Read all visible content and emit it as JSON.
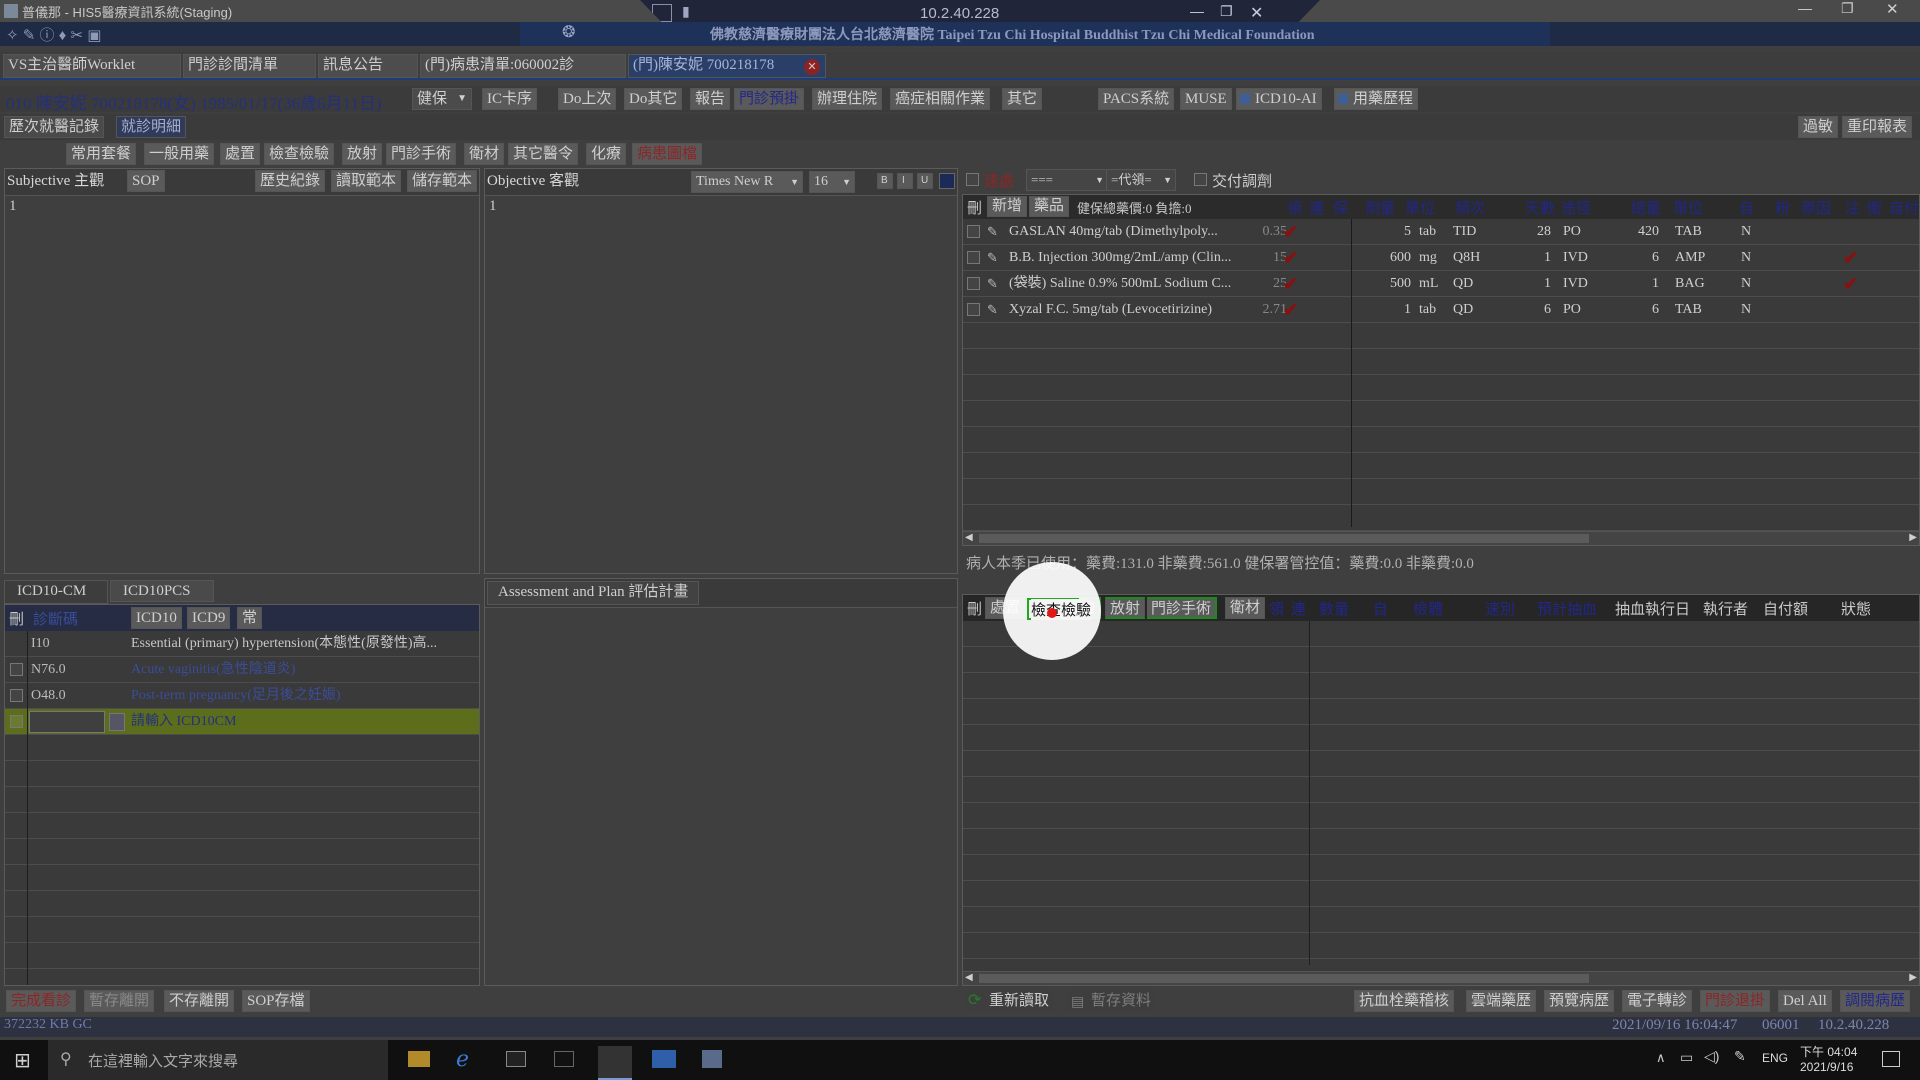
{
  "titlebar": {
    "title": "普儀那 - HIS5醫療資訊系統(Staging)",
    "remote_ip": "10.2.40.228",
    "hospital_banner": "佛教慈濟醫療財團法人台北慈濟醫院 Taipei Tzu Chi Hospital Buddhist Tzu Chi Medical Foundation"
  },
  "main_tabs": [
    "VS主治醫師Worklet",
    "門診診間清單",
    "訊息公告",
    "(門)病患清單:060002診",
    "(門)陳安妮 700218178"
  ],
  "patient": {
    "info": "010  陳安妮 700218178(女) 1985/01/17(36歲6月11日)",
    "insurance": "健保"
  },
  "patient_toolbar": [
    "IC卡序",
    "Do上次",
    "Do其它",
    "報告",
    "門診預掛",
    "辦理住院",
    "癌症相關作業",
    "其它",
    "PACS系統",
    "MUSE",
    "ICD10-AI",
    "用藥歷程"
  ],
  "subtabs": {
    "history": "歷次就醫記錄",
    "detail": "就診明細"
  },
  "right_buttons": {
    "allergy": "過敏",
    "reprint": "重印報表"
  },
  "order_toolbar": [
    "常用套餐",
    "一般用藥",
    "處置",
    "檢查檢驗",
    "放射",
    "門診手術",
    "衛材",
    "其它醫令",
    "化療",
    "病患圖檔"
  ],
  "subjective": {
    "title": "Subjective 主觀",
    "sop": "SOP",
    "history": "歷史紀錄",
    "read_tpl": "讀取範本",
    "save_tpl": "儲存範本",
    "text": "1"
  },
  "objective": {
    "title": "Objective 客觀",
    "font": "Times New R",
    "size": "16",
    "text": "1"
  },
  "drug_filters": {
    "same_place": "速處",
    "combo1": "===",
    "combo2": "=代領=",
    "deliver": "交付調劑"
  },
  "drug_table": {
    "headers": [
      "刪",
      "新增",
      "藥品",
      "健保總藥價:0 負擔:0",
      "領",
      "連",
      "保",
      "劑量",
      "單位",
      "頻次",
      "天數",
      "途徑",
      "總量",
      "單位",
      "自",
      "粉",
      "原因",
      "注",
      "衛",
      "自付"
    ],
    "rows": [
      {
        "name": "GASLAN 40mg/tab (Dimethylpoly...",
        "price": "0.35",
        "dose": "5",
        "unit": "tab",
        "freq": "TID",
        "days": "28",
        "route": "PO",
        "total": "420",
        "tunit": "TAB",
        "self": "N",
        "inj": false
      },
      {
        "name": "B.B. Injection 300mg/2mL/amp (Clin...",
        "price": "15",
        "dose": "600",
        "unit": "mg",
        "freq": "Q8H",
        "days": "1",
        "route": "IVD",
        "total": "6",
        "tunit": "AMP",
        "self": "N",
        "inj": true
      },
      {
        "name": "(袋裝) Saline 0.9% 500mL Sodium C...",
        "price": "25",
        "dose": "500",
        "unit": "mL",
        "freq": "QD",
        "days": "1",
        "route": "IVD",
        "total": "1",
        "tunit": "BAG",
        "self": "N",
        "inj": true
      },
      {
        "name": "Xyzal F.C. 5mg/tab (Levocetirizine)",
        "price": "2.71",
        "dose": "1",
        "unit": "tab",
        "freq": "QD",
        "days": "6",
        "route": "PO",
        "total": "6",
        "tunit": "TAB",
        "self": "N",
        "inj": false
      }
    ]
  },
  "usage_summary": "病人本季已使用：藥費:131.0 非藥費:561.0 健保署管控值：藥費:0.0 非藥費:0.0",
  "icd": {
    "tabs": [
      "ICD10-CM",
      "ICD10PCS"
    ],
    "headers": {
      "del": "刪",
      "code": "診斷碼",
      "icd10": "ICD10",
      "icd9": "ICD9",
      "common": "常"
    },
    "rows": [
      {
        "code": "I10",
        "desc": "Essential (primary) hypertension(本態性(原發性)高..."
      },
      {
        "code": "N76.0",
        "desc": "Acute vaginitis(急性陰道炎)"
      },
      {
        "code": "O48.0",
        "desc": "Post-term pregnancy(足月後之妊娠)"
      }
    ],
    "input_prompt": "請輸入 ICD10CM"
  },
  "assessment": {
    "title": "Assessment and Plan 評估計畫"
  },
  "lab_table": {
    "headers": [
      "刪",
      "處置",
      "檢查檢驗",
      "放射",
      "門診手術",
      "衛材",
      "領",
      "連",
      "數量",
      "自",
      "檢體",
      "速別",
      "預計抽血",
      "抽血執行日",
      "執行者",
      "自付額",
      "狀態"
    ]
  },
  "bottom_left": [
    "完成看診",
    "暫存離開",
    "不存離開",
    "SOP存檔"
  ],
  "bottom_mid": {
    "reload": "重新讀取",
    "temp": "暫存資料"
  },
  "bottom_right": [
    "抗血栓藥稽核",
    "雲端藥歷",
    "預覽病歷",
    "電子轉診",
    "門診退掛",
    "Del All",
    "調閱病歷"
  ],
  "statusbar": {
    "memory": "372232 KB  GC",
    "datetime": "2021/09/16 16:04:47",
    "station": "06001",
    "ip": "10.2.40.228"
  },
  "taskbar": {
    "search_placeholder": "在這裡輸入文字來搜尋",
    "lang": "ENG",
    "time": "下午 04:04",
    "date": "2021/9/16"
  }
}
